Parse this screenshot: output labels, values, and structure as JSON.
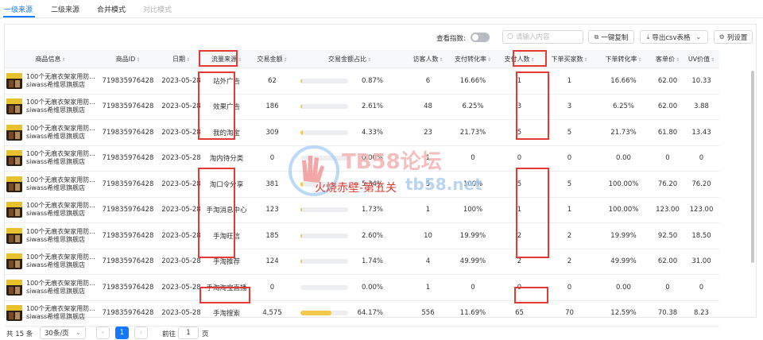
{
  "tabs": [
    {
      "label": "一级来源",
      "state": "active"
    },
    {
      "label": "二级来源",
      "state": "normal"
    },
    {
      "label": "合并模式",
      "state": "normal"
    },
    {
      "label": "对比模式",
      "state": "disabled"
    }
  ],
  "toolbar": {
    "toggle_label": "查看指数:",
    "toggle_on": false,
    "search_placeholder": "请输入内容",
    "copy_label": "一键复制",
    "export_label": "导出csv表格",
    "settings_label": "列设置"
  },
  "columns": [
    "商品信息",
    "商品ID",
    "日期",
    "流量来源",
    "交易金额",
    "交易金额占比",
    "访客人数",
    "支付转化率",
    "支付人数",
    "下单买家数",
    "下单转化率",
    "客单价",
    "UV价值"
  ],
  "rows": [
    {
      "name": "100个无痕衣架家用防...",
      "shop": "siwass希维思旗舰店",
      "id": "719835976428",
      "date": "2023-05-28",
      "source": "站外广告",
      "amount": "62",
      "share": "0.87%",
      "share_pct": 0.87,
      "visitors": "6",
      "pay_rate": "16.66%",
      "payers": "1",
      "buyers": "1",
      "order_rate": "16.66%",
      "aov": "62.00",
      "uv": "10.33"
    },
    {
      "name": "100个无痕衣架家用防...",
      "shop": "siwass希维思旗舰店",
      "id": "719835976428",
      "date": "2023-05-28",
      "source": "效果广告",
      "amount": "186",
      "share": "2.61%",
      "share_pct": 2.61,
      "visitors": "48",
      "pay_rate": "6.25%",
      "payers": "3",
      "buyers": "3",
      "order_rate": "6.25%",
      "aov": "62.00",
      "uv": "3.88"
    },
    {
      "name": "100个无痕衣架家用防...",
      "shop": "siwass希维思旗舰店",
      "id": "719835976428",
      "date": "2023-05-28",
      "source": "我的淘宝",
      "amount": "309",
      "share": "4.33%",
      "share_pct": 4.33,
      "visitors": "23",
      "pay_rate": "21.73%",
      "payers": "5",
      "buyers": "5",
      "order_rate": "21.73%",
      "aov": "61.80",
      "uv": "13.43"
    },
    {
      "name": "100个无痕衣架家用防...",
      "shop": "siwass希维思旗舰店",
      "id": "719835976428",
      "date": "2023-05-28",
      "source": "淘内待分类",
      "amount": "0",
      "share": "0.00%",
      "share_pct": 0,
      "visitors": "1",
      "pay_rate": "0",
      "payers": "0",
      "buyers": "0",
      "order_rate": "0.00",
      "aov": "0",
      "uv": "0"
    },
    {
      "name": "100个无痕衣架家用防...",
      "shop": "siwass希维思旗舰店",
      "id": "719835976428",
      "date": "2023-05-28",
      "source": "淘口令分享",
      "amount": "381",
      "share": "5.34%",
      "share_pct": 5.34,
      "visitors": "5",
      "pay_rate": "100%",
      "payers": "5",
      "buyers": "5",
      "order_rate": "100.00%",
      "aov": "76.20",
      "uv": "76.20"
    },
    {
      "name": "100个无痕衣架家用防...",
      "shop": "siwass希维思旗舰店",
      "id": "719835976428",
      "date": "2023-05-28",
      "source": "手淘消息中心",
      "amount": "123",
      "share": "1.73%",
      "share_pct": 1.73,
      "visitors": "1",
      "pay_rate": "100%",
      "payers": "1",
      "buyers": "1",
      "order_rate": "100.00%",
      "aov": "123.00",
      "uv": "123.00"
    },
    {
      "name": "100个无痕衣架家用防...",
      "shop": "siwass希维思旗舰店",
      "id": "719835976428",
      "date": "2023-05-28",
      "source": "手淘旺信",
      "amount": "185",
      "share": "2.60%",
      "share_pct": 2.6,
      "visitors": "10",
      "pay_rate": "19.99%",
      "payers": "2",
      "buyers": "2",
      "order_rate": "19.99%",
      "aov": "92.50",
      "uv": "18.50"
    },
    {
      "name": "100个无痕衣架家用防...",
      "shop": "siwass希维思旗舰店",
      "id": "719835976428",
      "date": "2023-05-28",
      "source": "手淘推荐",
      "amount": "124",
      "share": "1.74%",
      "share_pct": 1.74,
      "visitors": "4",
      "pay_rate": "49.99%",
      "payers": "2",
      "buyers": "2",
      "order_rate": "49.99%",
      "aov": "62.00",
      "uv": "31.00"
    },
    {
      "name": "100个无痕衣架家用防...",
      "shop": "siwass希维思旗舰店",
      "id": "719835976428",
      "date": "2023-05-28",
      "source": "手淘淘宝直播",
      "amount": "0",
      "share": "0.00%",
      "share_pct": 0,
      "visitors": "1",
      "pay_rate": "0",
      "payers": "0",
      "buyers": "0",
      "order_rate": "0.00",
      "aov": "0",
      "uv": "0"
    },
    {
      "name": "100个无痕衣架家用防...",
      "shop": "siwass希维思旗舰店",
      "id": "719835976428",
      "date": "2023-05-28",
      "source": "手淘搜索",
      "amount": "4,575",
      "share": "64.17%",
      "share_pct": 64.17,
      "visitors": "556",
      "pay_rate": "11.69%",
      "payers": "65",
      "buyers": "70",
      "order_rate": "12.59%",
      "aov": "70.38",
      "uv": "8.23"
    }
  ],
  "watermark": {
    "title": "TB58论坛",
    "url": "tb58.net",
    "caption": "火烧赤壁-第五关"
  },
  "pagination": {
    "total": "共 15 条",
    "page_size": "30条/页",
    "prev": "‹",
    "current": "1",
    "next": "›",
    "goto_label": "前往",
    "goto_value": "1",
    "page_suffix": "页"
  },
  "colors": {
    "accent": "#1677ff",
    "highlight": "#e53935",
    "bar": "#f2c94c"
  }
}
